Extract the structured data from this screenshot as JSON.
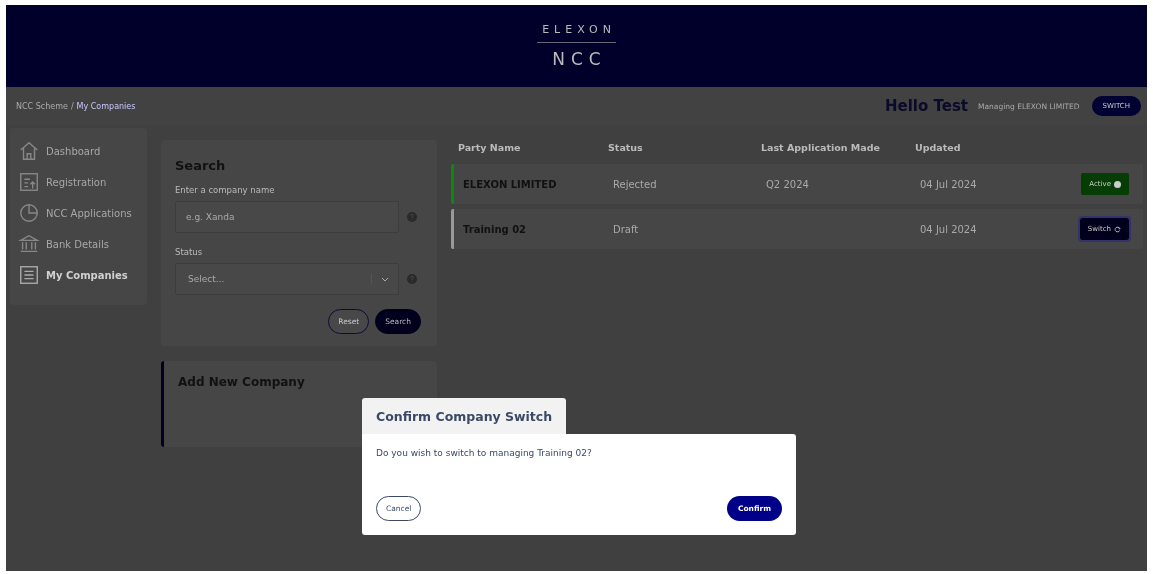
{
  "header": {
    "brand": "ELEXON",
    "product": "NCC"
  },
  "breadcrumb": {
    "items": [
      "NCC Scheme",
      "My Companies"
    ],
    "separator": "/"
  },
  "greeting": "Hello Test",
  "managing": "Managing ELEXON LIMITED",
  "switch_button": "SWITCH",
  "sidebar": {
    "items": [
      {
        "label": "Dashboard",
        "selected": false
      },
      {
        "label": "Registration",
        "selected": false
      },
      {
        "label": "NCC Applications",
        "selected": false
      },
      {
        "label": "Bank Details",
        "selected": false
      },
      {
        "label": "My Companies",
        "selected": true
      }
    ]
  },
  "search": {
    "title": "Search",
    "name_label": "Enter a company name",
    "name_placeholder": "e.g. Xanda",
    "status_label": "Status",
    "status_placeholder": "Select...",
    "reset": "Reset",
    "submit": "Search"
  },
  "add_company": {
    "title": "Add New Company"
  },
  "table": {
    "columns": [
      "Party Name",
      "Status",
      "Last Application Made",
      "Updated"
    ],
    "rows": [
      {
        "party": "ELEXON LIMITED",
        "status": "Rejected",
        "last_application": "Q2 2024",
        "updated": "04 Jul 2024",
        "action": {
          "kind": "active",
          "label": "Active"
        }
      },
      {
        "party": "Training 02",
        "status": "Draft",
        "updated": "04 Jul 2024",
        "action": {
          "kind": "switch",
          "label": "Switch"
        }
      }
    ]
  },
  "dialog": {
    "title": "Confirm Company Switch",
    "message": "Do you wish to switch to managing Training 02?",
    "cancel": "Cancel",
    "confirm": "Confirm"
  }
}
